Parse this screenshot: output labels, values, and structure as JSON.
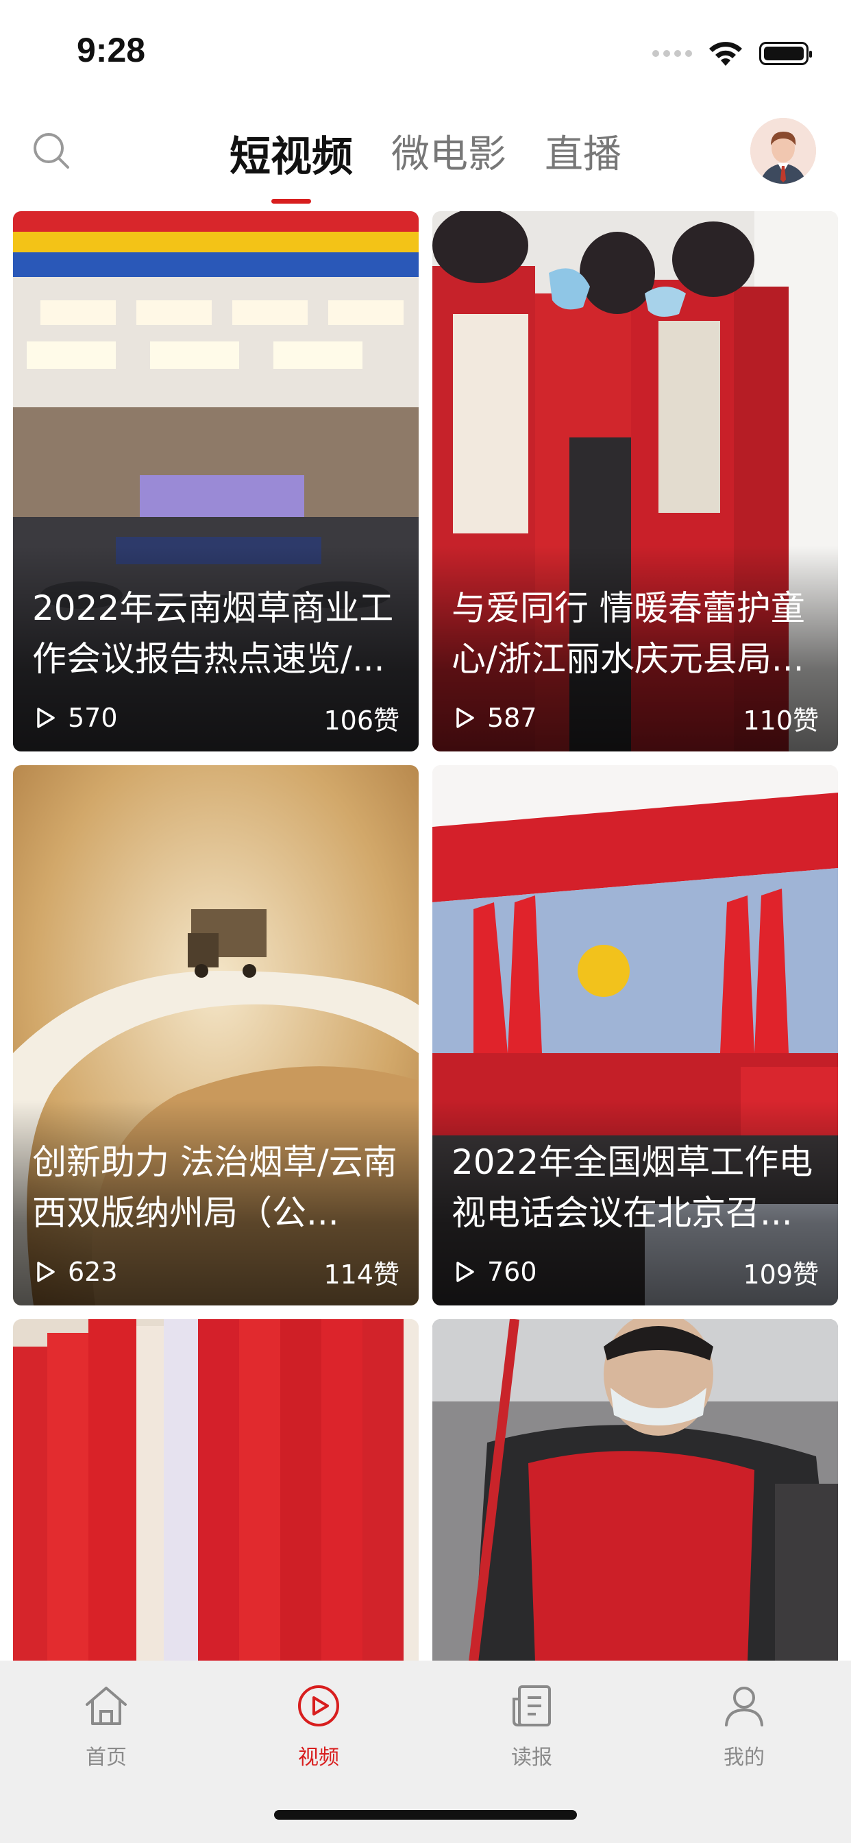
{
  "status_bar": {
    "time": "9:28"
  },
  "header": {
    "tabs": [
      {
        "label": "短视频",
        "active": true
      },
      {
        "label": "微电影",
        "active": false
      },
      {
        "label": "直播",
        "active": false
      }
    ]
  },
  "colors": {
    "accent": "#d81e1e",
    "tabbar_bg": "#efefef"
  },
  "videos": [
    {
      "title": "2022年云南烟草商业工作会议报告热点速览/...",
      "plays": "570",
      "likes": "106赞"
    },
    {
      "title": "与爱同行 情暖春蕾护童心/浙江丽水庆元县局...",
      "plays": "587",
      "likes": "110赞"
    },
    {
      "title": "创新助力 法治烟草/云南西双版纳州局（公...",
      "plays": "623",
      "likes": "114赞"
    },
    {
      "title": "2022年全国烟草工作电视电话会议在北京召...",
      "plays": "760",
      "likes": "109赞"
    }
  ],
  "tabbar": [
    {
      "label": "首页",
      "icon": "home-icon",
      "active": false
    },
    {
      "label": "视频",
      "icon": "play-circle-icon",
      "active": true
    },
    {
      "label": "读报",
      "icon": "newspaper-icon",
      "active": false
    },
    {
      "label": "我的",
      "icon": "person-icon",
      "active": false
    }
  ]
}
